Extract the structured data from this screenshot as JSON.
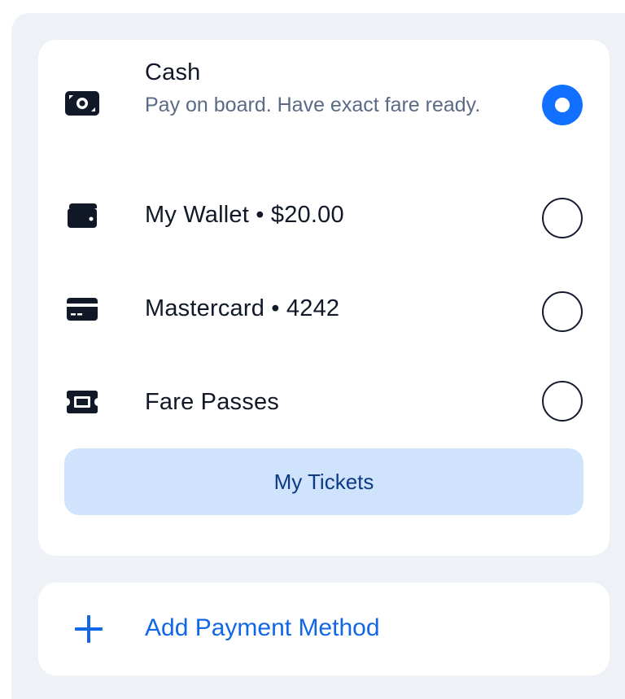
{
  "payment_options": [
    {
      "icon": "cash-icon",
      "title": "Cash",
      "description": "Pay on board. Have exact fare ready.",
      "selected": true
    },
    {
      "icon": "wallet-icon",
      "title": "My Wallet • $20.00",
      "selected": false
    },
    {
      "icon": "credit-card-icon",
      "title": "Mastercard • 4242",
      "selected": false
    },
    {
      "icon": "ticket-icon",
      "title": "Fare Passes",
      "selected": false
    }
  ],
  "tickets_button": {
    "label": "My Tickets"
  },
  "add_payment": {
    "icon": "plus-icon",
    "label": "Add Payment Method"
  },
  "colors": {
    "accent": "#1170ff",
    "tickets_button_bg": "#cfe3fc",
    "tickets_button_text": "#0d3a86",
    "link_text": "#1167e8",
    "background": "#eef1f5"
  }
}
